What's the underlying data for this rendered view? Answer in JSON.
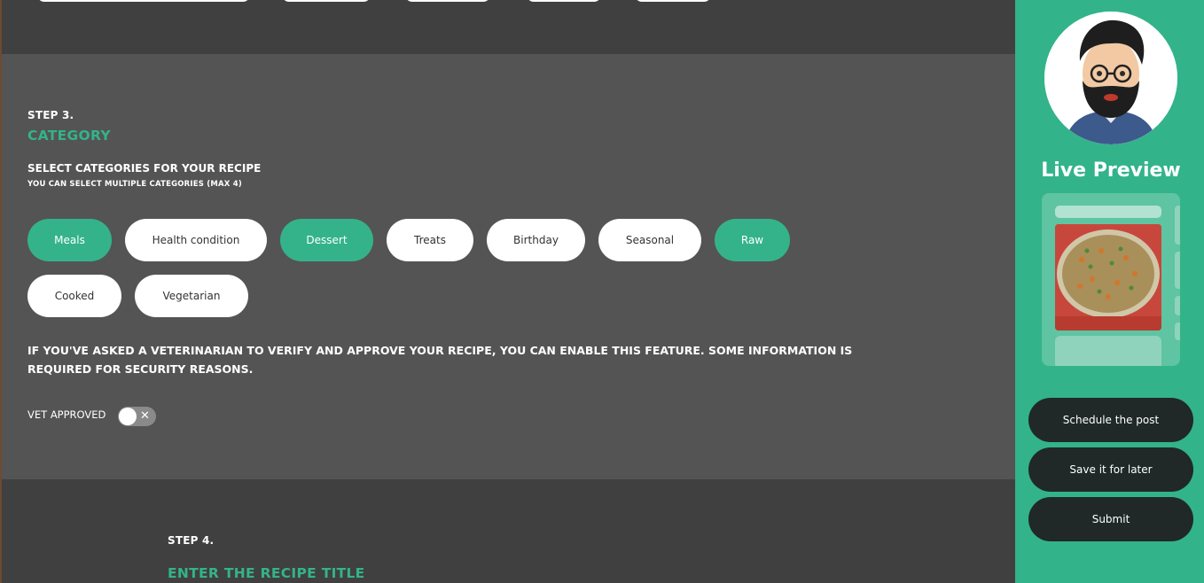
{
  "step3": {
    "label": "STEP 3.",
    "title": "CATEGORY",
    "subtitle": "SELECT CATEGORIES FOR YOUR RECIPE",
    "note": "YOU CAN SELECT MULTIPLE CATEGORIES (MAX 4)",
    "categories": [
      {
        "label": "Meals",
        "selected": true
      },
      {
        "label": "Health condition",
        "selected": false
      },
      {
        "label": "Dessert",
        "selected": true
      },
      {
        "label": "Treats",
        "selected": false
      },
      {
        "label": "Birthday",
        "selected": false
      },
      {
        "label": "Seasonal",
        "selected": false
      },
      {
        "label": "Raw",
        "selected": true
      },
      {
        "label": "Cooked",
        "selected": false
      },
      {
        "label": "Vegetarian",
        "selected": false
      }
    ],
    "vet_note": "IF YOU'VE ASKED A VETERINARIAN TO VERIFY AND APPROVE YOUR RECIPE, YOU CAN ENABLE THIS FEATURE. SOME INFORMATION IS REQUIRED FOR SECURITY REASONS.",
    "vet_label": "VET APPROVED",
    "vet_toggle_on": false,
    "vet_toggle_icon": "close-x"
  },
  "step4": {
    "label": "STEP 4.",
    "title": "ENTER THE RECIPE TITLE"
  },
  "sidebar": {
    "live_preview_title": "Live Preview",
    "actions": {
      "schedule": "Schedule the post",
      "save": "Save it for later",
      "submit": "Submit"
    }
  },
  "colors": {
    "accent": "#34b38a",
    "dark_button": "#202828",
    "panel": "#545454",
    "background": "#404040"
  }
}
